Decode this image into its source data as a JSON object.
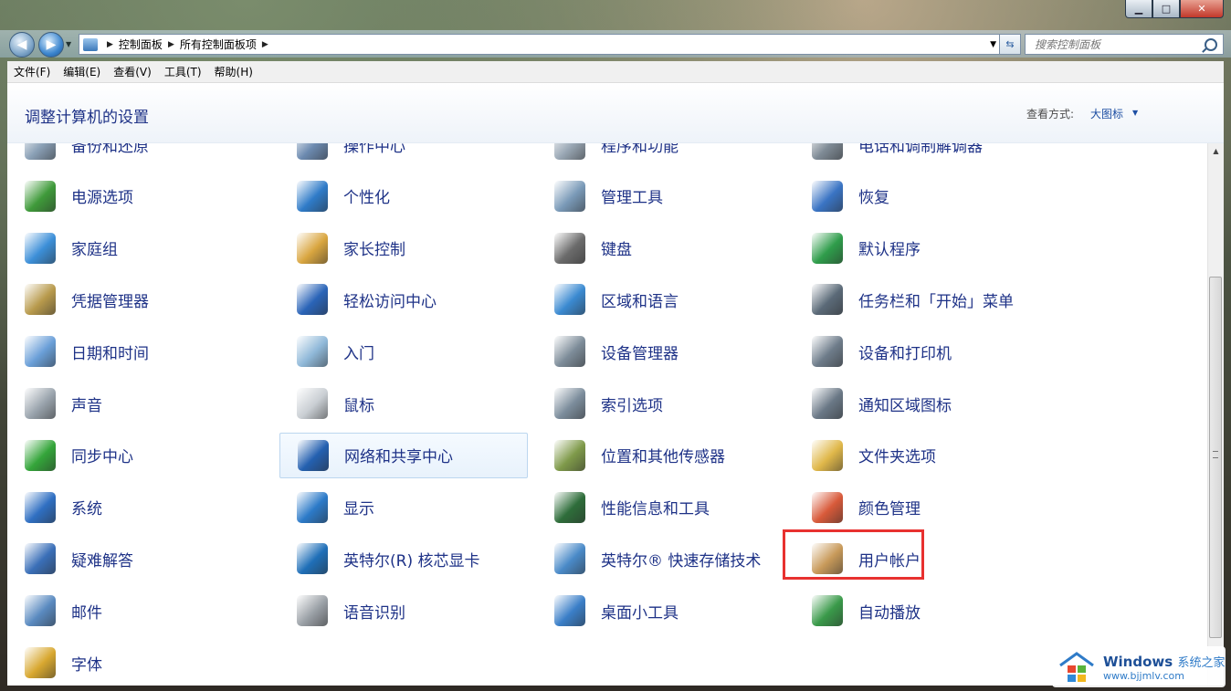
{
  "window": {
    "caption_buttons": {
      "minimize": "▁",
      "maximize": "□",
      "close": "✕"
    }
  },
  "address_bar": {
    "breadcrumbs": [
      "控制面板",
      "所有控制面板项"
    ],
    "search_placeholder": "搜索控制面板"
  },
  "menubar": {
    "items": [
      "文件(F)",
      "编辑(E)",
      "查看(V)",
      "工具(T)",
      "帮助(H)"
    ]
  },
  "header": {
    "title": "调整计算机的设置",
    "view_by_label": "查看方式:",
    "view_by_value": "大图标"
  },
  "items": [
    {
      "label": "备份和还原",
      "icon": "backup-icon",
      "color": "#8aa0b6"
    },
    {
      "label": "操作中心",
      "icon": "flag-icon",
      "color": "#6c8ab0"
    },
    {
      "label": "程序和功能",
      "icon": "programs-icon",
      "color": "#9aa8b5"
    },
    {
      "label": "电话和调制解调器",
      "icon": "modem-icon",
      "color": "#7f8b96"
    },
    {
      "label": "电源选项",
      "icon": "power-icon",
      "color": "#3f9a3a"
    },
    {
      "label": "个性化",
      "icon": "personalize-icon",
      "color": "#2f7bc8"
    },
    {
      "label": "管理工具",
      "icon": "admin-tools-icon",
      "color": "#7a9ab8"
    },
    {
      "label": "恢复",
      "icon": "recovery-icon",
      "color": "#3a74c4"
    },
    {
      "label": "家庭组",
      "icon": "homegroup-icon",
      "color": "#3c8fd8"
    },
    {
      "label": "家长控制",
      "icon": "parental-icon",
      "color": "#d9a640"
    },
    {
      "label": "键盘",
      "icon": "keyboard-icon",
      "color": "#6b6b6b"
    },
    {
      "label": "默认程序",
      "icon": "default-programs-icon",
      "color": "#2f9d4b"
    },
    {
      "label": "凭据管理器",
      "icon": "credential-icon",
      "color": "#b89a4c"
    },
    {
      "label": "轻松访问中心",
      "icon": "ease-access-icon",
      "color": "#2a64b8"
    },
    {
      "label": "区域和语言",
      "icon": "globe-icon",
      "color": "#3b8ad1"
    },
    {
      "label": "任务栏和「开始」菜单",
      "icon": "taskbar-icon",
      "color": "#5b6a78"
    },
    {
      "label": "日期和时间",
      "icon": "calendar-clock-icon",
      "color": "#6a9fd8"
    },
    {
      "label": "入门",
      "icon": "getting-started-icon",
      "color": "#8fb8d8"
    },
    {
      "label": "设备管理器",
      "icon": "device-manager-icon",
      "color": "#7d8c99"
    },
    {
      "label": "设备和打印机",
      "icon": "printer-icon",
      "color": "#6e7c8a"
    },
    {
      "label": "声音",
      "icon": "speaker-icon",
      "color": "#9aa4ad"
    },
    {
      "label": "鼠标",
      "icon": "mouse-icon",
      "color": "#c9ced3"
    },
    {
      "label": "索引选项",
      "icon": "index-icon",
      "color": "#7c8d9c"
    },
    {
      "label": "通知区域图标",
      "icon": "notification-icon",
      "color": "#6a7886"
    },
    {
      "label": "同步中心",
      "icon": "sync-icon",
      "color": "#34a53a"
    },
    {
      "label": "网络和共享中心",
      "icon": "network-icon",
      "color": "#2460b0"
    },
    {
      "label": "位置和其他传感器",
      "icon": "sensor-icon",
      "color": "#7f9a4a"
    },
    {
      "label": "文件夹选项",
      "icon": "folder-icon",
      "color": "#e0b84a"
    },
    {
      "label": "系统",
      "icon": "system-icon",
      "color": "#2f6fc2"
    },
    {
      "label": "显示",
      "icon": "display-icon",
      "color": "#2c7ac8"
    },
    {
      "label": "性能信息和工具",
      "icon": "performance-icon",
      "color": "#2e6d3a"
    },
    {
      "label": "颜色管理",
      "icon": "color-mgmt-icon",
      "color": "#d85a3a"
    },
    {
      "label": "疑难解答",
      "icon": "troubleshoot-icon",
      "color": "#3a6fb8"
    },
    {
      "label": "英特尔(R) 核芯显卡",
      "icon": "intel-graphics-icon",
      "color": "#1f6fb8"
    },
    {
      "label": "英特尔® 快速存储技术",
      "icon": "intel-storage-icon",
      "color": "#4a8ac8"
    },
    {
      "label": "用户帐户",
      "icon": "users-icon",
      "color": "#c89a5a"
    },
    {
      "label": "邮件",
      "icon": "mail-icon",
      "color": "#5a8ac0"
    },
    {
      "label": "语音识别",
      "icon": "microphone-icon",
      "color": "#9aa0a6"
    },
    {
      "label": "桌面小工具",
      "icon": "gadgets-icon",
      "color": "#3b7fc8"
    },
    {
      "label": "自动播放",
      "icon": "autoplay-icon",
      "color": "#3a9a4a"
    },
    {
      "label": "字体",
      "icon": "font-icon",
      "color": "#d8a830"
    }
  ],
  "watermark": {
    "brand": "Windows",
    "brand_suffix": "系统之家",
    "url": "www.bjjmlv.com"
  },
  "colors": {
    "link_blue": "#1e3287",
    "highlight_red": "#e8312f"
  }
}
